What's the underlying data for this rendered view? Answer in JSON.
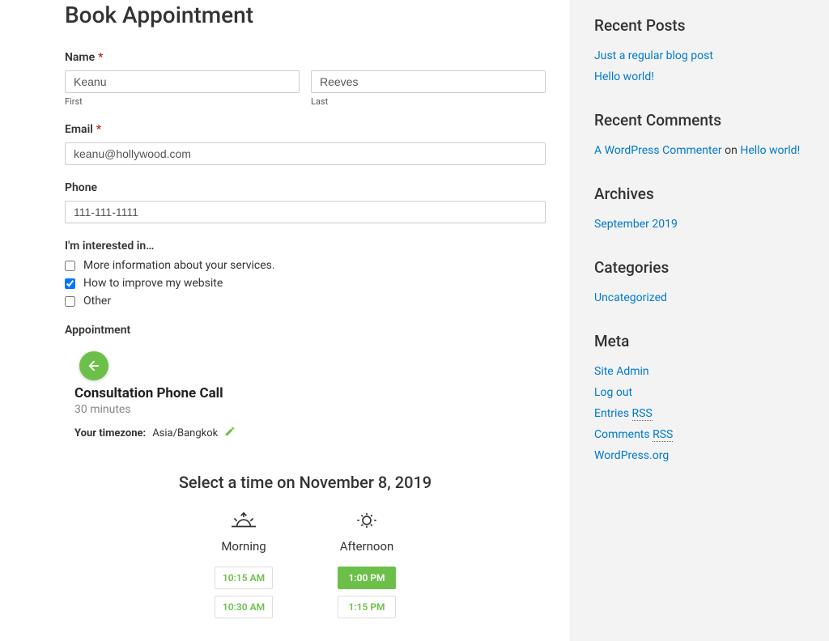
{
  "page": {
    "title": "Book Appointment"
  },
  "form": {
    "name": {
      "label": "Name",
      "first": "Keanu",
      "first_sub": "First",
      "last": "Reeves",
      "last_sub": "Last"
    },
    "email": {
      "label": "Email",
      "value": "keanu@hollywood.com"
    },
    "phone": {
      "label": "Phone",
      "value": "111-111-1111"
    },
    "interest": {
      "label": "I'm interested in…",
      "opt0": "More information about your services.",
      "opt1": "How to improve my website",
      "opt2": "Other"
    }
  },
  "appointment": {
    "label": "Appointment",
    "service_title": "Consultation Phone Call",
    "duration": "30 minutes",
    "tz_label": "Your timezone:",
    "tz_value": "Asia/Bangkok",
    "select_time": "Select a time on November 8, 2019",
    "morning_label": "Morning",
    "afternoon_label": "Afternoon",
    "morning": {
      "s0": "10:15 AM",
      "s1": "10:30 AM"
    },
    "afternoon": {
      "s0": "1:00 PM",
      "s1": "1:15 PM"
    }
  },
  "sidebar": {
    "recent_posts": {
      "title": "Recent Posts",
      "p0": "Just a regular blog post",
      "p1": "Hello world!"
    },
    "recent_comments": {
      "title": "Recent Comments",
      "author": "A WordPress Commenter",
      "on": " on ",
      "post": "Hello world!"
    },
    "archives": {
      "title": "Archives",
      "a0": "September 2019"
    },
    "categories": {
      "title": "Categories",
      "c0": "Uncategorized"
    },
    "meta": {
      "title": "Meta",
      "m0": "Site Admin",
      "m1": "Log out",
      "m2a": "Entries ",
      "m2b": "RSS",
      "m3a": "Comments ",
      "m3b": "RSS",
      "m4": "WordPress.org"
    }
  }
}
